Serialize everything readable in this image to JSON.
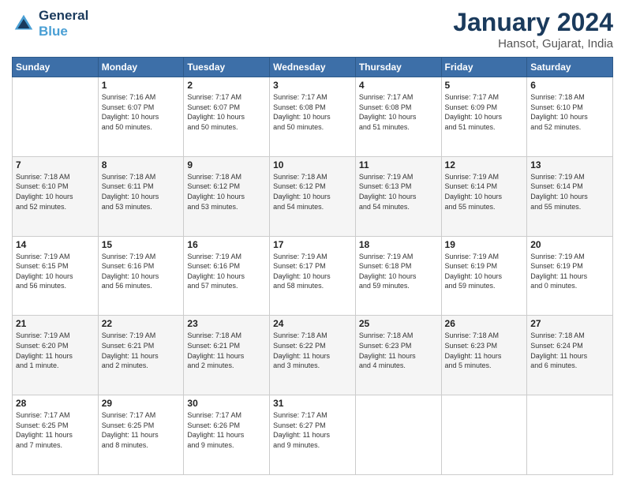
{
  "header": {
    "logo_line1": "General",
    "logo_line2": "Blue",
    "month": "January 2024",
    "location": "Hansot, Gujarat, India"
  },
  "weekdays": [
    "Sunday",
    "Monday",
    "Tuesday",
    "Wednesday",
    "Thursday",
    "Friday",
    "Saturday"
  ],
  "weeks": [
    [
      {
        "day": "",
        "info": ""
      },
      {
        "day": "1",
        "info": "Sunrise: 7:16 AM\nSunset: 6:07 PM\nDaylight: 10 hours\nand 50 minutes."
      },
      {
        "day": "2",
        "info": "Sunrise: 7:17 AM\nSunset: 6:07 PM\nDaylight: 10 hours\nand 50 minutes."
      },
      {
        "day": "3",
        "info": "Sunrise: 7:17 AM\nSunset: 6:08 PM\nDaylight: 10 hours\nand 50 minutes."
      },
      {
        "day": "4",
        "info": "Sunrise: 7:17 AM\nSunset: 6:08 PM\nDaylight: 10 hours\nand 51 minutes."
      },
      {
        "day": "5",
        "info": "Sunrise: 7:17 AM\nSunset: 6:09 PM\nDaylight: 10 hours\nand 51 minutes."
      },
      {
        "day": "6",
        "info": "Sunrise: 7:18 AM\nSunset: 6:10 PM\nDaylight: 10 hours\nand 52 minutes."
      }
    ],
    [
      {
        "day": "7",
        "info": "Sunrise: 7:18 AM\nSunset: 6:10 PM\nDaylight: 10 hours\nand 52 minutes."
      },
      {
        "day": "8",
        "info": "Sunrise: 7:18 AM\nSunset: 6:11 PM\nDaylight: 10 hours\nand 53 minutes."
      },
      {
        "day": "9",
        "info": "Sunrise: 7:18 AM\nSunset: 6:12 PM\nDaylight: 10 hours\nand 53 minutes."
      },
      {
        "day": "10",
        "info": "Sunrise: 7:18 AM\nSunset: 6:12 PM\nDaylight: 10 hours\nand 54 minutes."
      },
      {
        "day": "11",
        "info": "Sunrise: 7:19 AM\nSunset: 6:13 PM\nDaylight: 10 hours\nand 54 minutes."
      },
      {
        "day": "12",
        "info": "Sunrise: 7:19 AM\nSunset: 6:14 PM\nDaylight: 10 hours\nand 55 minutes."
      },
      {
        "day": "13",
        "info": "Sunrise: 7:19 AM\nSunset: 6:14 PM\nDaylight: 10 hours\nand 55 minutes."
      }
    ],
    [
      {
        "day": "14",
        "info": "Sunrise: 7:19 AM\nSunset: 6:15 PM\nDaylight: 10 hours\nand 56 minutes."
      },
      {
        "day": "15",
        "info": "Sunrise: 7:19 AM\nSunset: 6:16 PM\nDaylight: 10 hours\nand 56 minutes."
      },
      {
        "day": "16",
        "info": "Sunrise: 7:19 AM\nSunset: 6:16 PM\nDaylight: 10 hours\nand 57 minutes."
      },
      {
        "day": "17",
        "info": "Sunrise: 7:19 AM\nSunset: 6:17 PM\nDaylight: 10 hours\nand 58 minutes."
      },
      {
        "day": "18",
        "info": "Sunrise: 7:19 AM\nSunset: 6:18 PM\nDaylight: 10 hours\nand 59 minutes."
      },
      {
        "day": "19",
        "info": "Sunrise: 7:19 AM\nSunset: 6:19 PM\nDaylight: 10 hours\nand 59 minutes."
      },
      {
        "day": "20",
        "info": "Sunrise: 7:19 AM\nSunset: 6:19 PM\nDaylight: 11 hours\nand 0 minutes."
      }
    ],
    [
      {
        "day": "21",
        "info": "Sunrise: 7:19 AM\nSunset: 6:20 PM\nDaylight: 11 hours\nand 1 minute."
      },
      {
        "day": "22",
        "info": "Sunrise: 7:19 AM\nSunset: 6:21 PM\nDaylight: 11 hours\nand 2 minutes."
      },
      {
        "day": "23",
        "info": "Sunrise: 7:18 AM\nSunset: 6:21 PM\nDaylight: 11 hours\nand 2 minutes."
      },
      {
        "day": "24",
        "info": "Sunrise: 7:18 AM\nSunset: 6:22 PM\nDaylight: 11 hours\nand 3 minutes."
      },
      {
        "day": "25",
        "info": "Sunrise: 7:18 AM\nSunset: 6:23 PM\nDaylight: 11 hours\nand 4 minutes."
      },
      {
        "day": "26",
        "info": "Sunrise: 7:18 AM\nSunset: 6:23 PM\nDaylight: 11 hours\nand 5 minutes."
      },
      {
        "day": "27",
        "info": "Sunrise: 7:18 AM\nSunset: 6:24 PM\nDaylight: 11 hours\nand 6 minutes."
      }
    ],
    [
      {
        "day": "28",
        "info": "Sunrise: 7:17 AM\nSunset: 6:25 PM\nDaylight: 11 hours\nand 7 minutes."
      },
      {
        "day": "29",
        "info": "Sunrise: 7:17 AM\nSunset: 6:25 PM\nDaylight: 11 hours\nand 8 minutes."
      },
      {
        "day": "30",
        "info": "Sunrise: 7:17 AM\nSunset: 6:26 PM\nDaylight: 11 hours\nand 9 minutes."
      },
      {
        "day": "31",
        "info": "Sunrise: 7:17 AM\nSunset: 6:27 PM\nDaylight: 11 hours\nand 9 minutes."
      },
      {
        "day": "",
        "info": ""
      },
      {
        "day": "",
        "info": ""
      },
      {
        "day": "",
        "info": ""
      }
    ]
  ]
}
